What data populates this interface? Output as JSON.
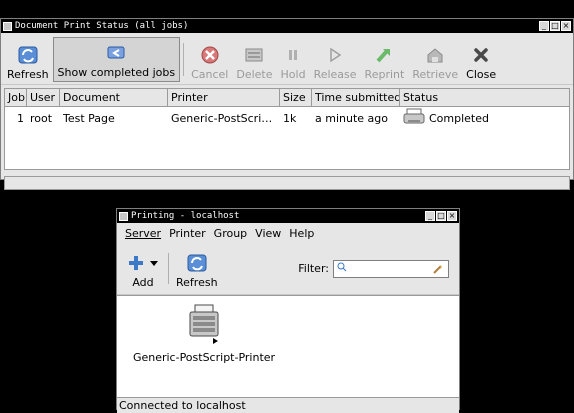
{
  "jobs_window": {
    "title": "Document Print Status (all jobs)",
    "toolbar": [
      {
        "label": "Refresh",
        "icon": "refresh-icon",
        "enabled": true,
        "pressed": false
      },
      {
        "label": "Show completed jobs",
        "icon": "show-completed-icon",
        "enabled": true,
        "pressed": true
      },
      {
        "label": "Cancel",
        "icon": "cancel-icon",
        "enabled": false,
        "pressed": false
      },
      {
        "label": "Delete",
        "icon": "delete-icon",
        "enabled": false,
        "pressed": false
      },
      {
        "label": "Hold",
        "icon": "hold-icon",
        "enabled": false,
        "pressed": false
      },
      {
        "label": "Release",
        "icon": "release-icon",
        "enabled": false,
        "pressed": false
      },
      {
        "label": "Reprint",
        "icon": "reprint-icon",
        "enabled": false,
        "pressed": false
      },
      {
        "label": "Retrieve",
        "icon": "retrieve-icon",
        "enabled": false,
        "pressed": false
      },
      {
        "label": "Close",
        "icon": "close-icon",
        "enabled": true,
        "pressed": false
      }
    ],
    "columns": [
      "Job",
      "User",
      "Document",
      "Printer",
      "Size",
      "Time submitted",
      "Status"
    ],
    "rows": [
      {
        "job": "1",
        "user": "root",
        "document": "Test Page",
        "printer": "Generic-PostScri…",
        "size": "1k",
        "time": "a minute ago",
        "status": "Completed"
      }
    ]
  },
  "printing_window": {
    "title": "Printing - localhost",
    "menus": [
      "Server",
      "Printer",
      "Group",
      "View",
      "Help"
    ],
    "toolbar": {
      "add_label": "Add",
      "refresh_label": "Refresh",
      "filter_label": "Filter:",
      "filter_value": ""
    },
    "printers": [
      {
        "name": "Generic-PostScript-Printer"
      }
    ],
    "status": "Connected to localhost"
  },
  "colors": {
    "refresh_blue": "#3a78c8",
    "cancel_red": "#c84848",
    "reprint_green": "#3a9a3a"
  }
}
